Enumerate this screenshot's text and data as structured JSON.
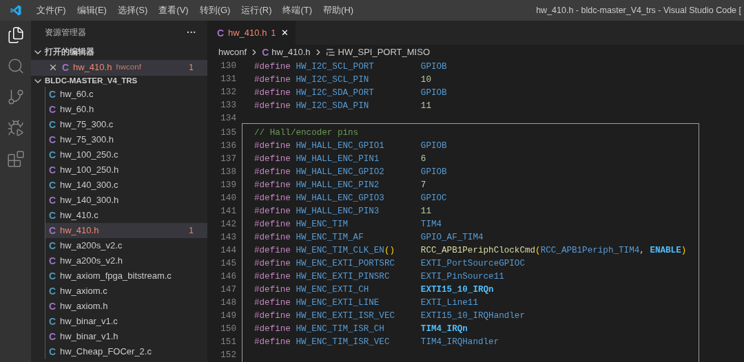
{
  "title_bar": {
    "menu": [
      "文件(F)",
      "编辑(E)",
      "选择(S)",
      "查看(V)",
      "转到(G)",
      "运行(R)",
      "终端(T)",
      "帮助(H)"
    ],
    "title": "hw_410.h - bldc-master_V4_trs - Visual Studio Code ["
  },
  "activity_bar": [
    {
      "kind": "files",
      "selected": true
    },
    {
      "kind": "search",
      "selected": false
    },
    {
      "kind": "source_control",
      "selected": false
    },
    {
      "kind": "debug",
      "selected": false
    },
    {
      "kind": "extensions",
      "selected": false
    }
  ],
  "sidebar": {
    "title": "资源管理器",
    "more": "···",
    "open_editors": {
      "title": "打开的编辑器",
      "expanded": true,
      "items": [
        {
          "kind": "h",
          "icon": "C",
          "name": "hw_410.h",
          "folder": "hwconf",
          "badge": "1",
          "has_error": true,
          "selected": true
        }
      ]
    },
    "workspace": {
      "title": "BLDC-MASTER_V4_TRS",
      "expanded": true,
      "files": [
        {
          "kind": "c",
          "icon": "C",
          "name": "hw_60.c",
          "has_error": false,
          "selected": false
        },
        {
          "kind": "h",
          "icon": "C",
          "name": "hw_60.h",
          "has_error": false,
          "selected": false
        },
        {
          "kind": "c",
          "icon": "C",
          "name": "hw_75_300.c",
          "has_error": false,
          "selected": false
        },
        {
          "kind": "h",
          "icon": "C",
          "name": "hw_75_300.h",
          "has_error": false,
          "selected": false
        },
        {
          "kind": "c",
          "icon": "C",
          "name": "hw_100_250.c",
          "has_error": false,
          "selected": false
        },
        {
          "kind": "h",
          "icon": "C",
          "name": "hw_100_250.h",
          "has_error": false,
          "selected": false
        },
        {
          "kind": "c",
          "icon": "C",
          "name": "hw_140_300.c",
          "has_error": false,
          "selected": false
        },
        {
          "kind": "h",
          "icon": "C",
          "name": "hw_140_300.h",
          "has_error": false,
          "selected": false
        },
        {
          "kind": "c",
          "icon": "C",
          "name": "hw_410.c",
          "has_error": false,
          "selected": false
        },
        {
          "kind": "h",
          "icon": "C",
          "name": "hw_410.h",
          "has_error": true,
          "badge": "1",
          "selected": true
        },
        {
          "kind": "c",
          "icon": "C",
          "name": "hw_a200s_v2.c",
          "has_error": false,
          "selected": false
        },
        {
          "kind": "h",
          "icon": "C",
          "name": "hw_a200s_v2.h",
          "has_error": false,
          "selected": false
        },
        {
          "kind": "c",
          "icon": "C",
          "name": "hw_axiom_fpga_bitstream.c",
          "has_error": false,
          "selected": false
        },
        {
          "kind": "c",
          "icon": "C",
          "name": "hw_axiom.c",
          "has_error": false,
          "selected": false
        },
        {
          "kind": "h",
          "icon": "C",
          "name": "hw_axiom.h",
          "has_error": false,
          "selected": false
        },
        {
          "kind": "c",
          "icon": "C",
          "name": "hw_binar_v1.c",
          "has_error": false,
          "selected": false
        },
        {
          "kind": "h",
          "icon": "C",
          "name": "hw_binar_v1.h",
          "has_error": false,
          "selected": false
        },
        {
          "kind": "c",
          "icon": "C",
          "name": "hw_Cheap_FOCer_2.c",
          "has_error": false,
          "selected": false
        }
      ]
    }
  },
  "tabs": [
    {
      "kind": "h",
      "icon": "C",
      "label": "hw_410.h",
      "badge": "1",
      "close": "✕",
      "selected": true,
      "has_error": true
    }
  ],
  "breadcrumb": [
    {
      "kind": "folder",
      "label": "hwconf"
    },
    {
      "kind": "h",
      "icon": "C",
      "label": "hw_410.h"
    },
    {
      "kind": "symbol",
      "label": "HW_SPI_PORT_MISO"
    }
  ],
  "code_blocks": [
    {
      "framed": false,
      "lines": [
        {
          "number": "130",
          "directive": "#define",
          "name": [
            {
              "kind": "macro",
              "text": "HW_I2C_SCL_PORT"
            }
          ],
          "value": [
            {
              "kind": "macro",
              "text": "GPIOB"
            }
          ]
        },
        {
          "number": "131",
          "directive": "#define",
          "name": [
            {
              "kind": "macro",
              "text": "HW_I2C_SCL_PIN"
            }
          ],
          "value": [
            {
              "kind": "number",
              "text": "10"
            }
          ]
        },
        {
          "number": "132",
          "directive": "#define",
          "name": [
            {
              "kind": "macro",
              "text": "HW_I2C_SDA_PORT"
            }
          ],
          "value": [
            {
              "kind": "macro",
              "text": "GPIOB"
            }
          ]
        },
        {
          "number": "133",
          "directive": "#define",
          "name": [
            {
              "kind": "macro",
              "text": "HW_I2C_SDA_PIN"
            }
          ],
          "value": [
            {
              "kind": "number",
              "text": "11"
            }
          ]
        },
        {
          "number": "134"
        }
      ]
    },
    {
      "framed": true,
      "lines": [
        {
          "number": "135",
          "comment": "// Hall/encoder pins"
        },
        {
          "number": "136",
          "directive": "#define",
          "name": [
            {
              "kind": "macro",
              "text": "HW_HALL_ENC_GPIO1"
            }
          ],
          "value": [
            {
              "kind": "macro",
              "text": "GPIOB"
            }
          ]
        },
        {
          "number": "137",
          "directive": "#define",
          "name": [
            {
              "kind": "macro",
              "text": "HW_HALL_ENC_PIN1"
            }
          ],
          "value": [
            {
              "kind": "number",
              "text": "6"
            }
          ]
        },
        {
          "number": "138",
          "directive": "#define",
          "name": [
            {
              "kind": "macro",
              "text": "HW_HALL_ENC_GPIO2"
            }
          ],
          "value": [
            {
              "kind": "macro",
              "text": "GPIOB"
            }
          ]
        },
        {
          "number": "139",
          "directive": "#define",
          "name": [
            {
              "kind": "macro",
              "text": "HW_HALL_ENC_PIN2"
            }
          ],
          "value": [
            {
              "kind": "number",
              "text": "7"
            }
          ]
        },
        {
          "number": "140",
          "directive": "#define",
          "name": [
            {
              "kind": "macro",
              "text": "HW_HALL_ENC_GPIO3"
            }
          ],
          "value": [
            {
              "kind": "macro",
              "text": "GPIOC"
            }
          ]
        },
        {
          "number": "141",
          "directive": "#define",
          "name": [
            {
              "kind": "macro",
              "text": "HW_HALL_ENC_PIN3"
            }
          ],
          "value": [
            {
              "kind": "number",
              "text": "11"
            }
          ]
        },
        {
          "number": "142",
          "directive": "#define",
          "name": [
            {
              "kind": "macro",
              "text": "HW_ENC_TIM"
            }
          ],
          "value": [
            {
              "kind": "macro",
              "text": "TIM4"
            }
          ]
        },
        {
          "number": "143",
          "directive": "#define",
          "name": [
            {
              "kind": "macro",
              "text": "HW_ENC_TIM_AF"
            }
          ],
          "value": [
            {
              "kind": "macro",
              "text": "GPIO_AF_TIM4"
            }
          ]
        },
        {
          "number": "144",
          "directive": "#define",
          "name": [
            {
              "kind": "macro",
              "text": "HW_ENC_TIM_CLK_EN"
            },
            {
              "kind": "paren",
              "text": "()"
            }
          ],
          "value": [
            {
              "kind": "function",
              "text": "RCC_APB1PeriphClockCmd"
            },
            {
              "kind": "paren",
              "text": "("
            },
            {
              "kind": "macro",
              "text": "RCC_APB1Periph_TIM4"
            },
            {
              "kind": "plain",
              "text": ", "
            },
            {
              "kind": "enum",
              "text": "ENABLE"
            },
            {
              "kind": "paren",
              "text": ")"
            }
          ]
        },
        {
          "number": "145",
          "directive": "#define",
          "name": [
            {
              "kind": "macro",
              "text": "HW_ENC_EXTI_PORTSRC"
            }
          ],
          "value": [
            {
              "kind": "macro",
              "text": "EXTI_PortSourceGPIOC"
            }
          ]
        },
        {
          "number": "146",
          "directive": "#define",
          "name": [
            {
              "kind": "macro",
              "text": "HW_ENC_EXTI_PINSRC"
            }
          ],
          "value": [
            {
              "kind": "macro",
              "text": "EXTI_PinSource11"
            }
          ]
        },
        {
          "number": "147",
          "directive": "#define",
          "name": [
            {
              "kind": "macro",
              "text": "HW_ENC_EXTI_CH"
            }
          ],
          "value": [
            {
              "kind": "enum",
              "text": "EXTI15_10_IRQn"
            }
          ]
        },
        {
          "number": "148",
          "directive": "#define",
          "name": [
            {
              "kind": "macro",
              "text": "HW_ENC_EXTI_LINE"
            }
          ],
          "value": [
            {
              "kind": "macro",
              "text": "EXTI_Line11"
            }
          ]
        },
        {
          "number": "149",
          "directive": "#define",
          "name": [
            {
              "kind": "macro",
              "text": "HW_ENC_EXTI_ISR_VEC"
            }
          ],
          "value": [
            {
              "kind": "macro",
              "text": "EXTI15_10_IRQHandler"
            }
          ]
        },
        {
          "number": "150",
          "directive": "#define",
          "name": [
            {
              "kind": "macro",
              "text": "HW_ENC_TIM_ISR_CH"
            }
          ],
          "value": [
            {
              "kind": "enum",
              "text": "TIM4_IRQn"
            }
          ]
        },
        {
          "number": "151",
          "directive": "#define",
          "name": [
            {
              "kind": "macro",
              "text": "HW_ENC_TIM_ISR_VEC"
            }
          ],
          "value": [
            {
              "kind": "macro",
              "text": "TIM4_IRQHandler"
            }
          ]
        },
        {
          "number": "152"
        }
      ]
    }
  ]
}
